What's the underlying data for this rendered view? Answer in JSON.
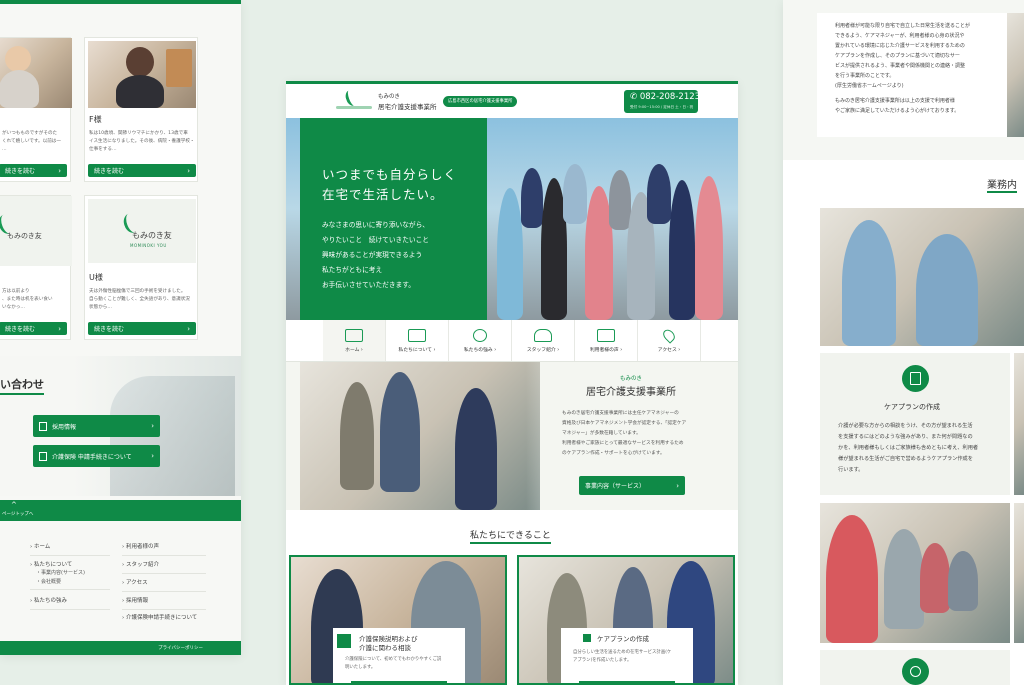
{
  "left": {
    "cards": [
      {
        "name": "",
        "text": "がいつもものですがそのた\nくれて嬉しいです。以前は一\n…",
        "button": "続きを読む"
      },
      {
        "name": "F様",
        "text": "私は10歳頃、関節リウマチにかかり、13歳で車\nイス生活になりました。その後、病院・養護学校・\n仕事をする…",
        "button": "続きを読む"
      },
      {
        "name": "",
        "text": "方は以前より\n、また時は机を表い食い\nいなかっ…",
        "button": "続きを読む"
      },
      {
        "name": "U様",
        "text": "夫は外傷性脳挫傷で三回の手術を受けました。\n自ら動くことが難しく、全失語があり、意識状況\n状態から…",
        "button": "続きを読む"
      }
    ],
    "logo_text": "もみのき友",
    "logo_sub": "MOMINOKI YOU",
    "contact_heading": "い合わせ",
    "contact_buttons": [
      "採用情報",
      "介護保険 申請手続きについて"
    ],
    "page_top": "ページトップへ",
    "footer_col1": [
      "ホーム",
      "私たちについて",
      "・事業内容(サービス)",
      "・会社概要",
      "私たちの強み"
    ],
    "footer_col2": [
      "利用者様の声",
      "スタッフ紹介",
      "アクセス",
      "採用情報",
      "介護保険申請手続きについて"
    ],
    "privacy": "プライバシーポリシー"
  },
  "center": {
    "logo_small": "もみのき",
    "logo_main": "居宅介護支援事業所",
    "badge": "広島市西区の居宅介護支援事業所",
    "phone": "082-208-2123",
    "hours": "受付 9:00~15:00 / 定休日 土・日・祝",
    "hero_title_1": "いつまでも自分らしく",
    "hero_title_2": "在宅で生活したい。",
    "hero_body": [
      "みなさまの思いに寄り添いながら、",
      "やりたいこと　続けていきたいこと",
      "興味があることが実現できるよう",
      "私たちがともに考え",
      "お手伝いさせていただきます。"
    ],
    "nav": [
      {
        "label": "ホーム",
        "icon": "home-icon"
      },
      {
        "label": "私たちについて",
        "icon": "book-icon"
      },
      {
        "label": "私たちの強み",
        "icon": "heart-hand-icon"
      },
      {
        "label": "スタッフ紹介",
        "icon": "staff-icon"
      },
      {
        "label": "利用者様の声",
        "icon": "chat-icon"
      },
      {
        "label": "アクセス",
        "icon": "map-pin-icon"
      }
    ],
    "about_small": "もみのき",
    "about_title": "居宅介護支援事業所",
    "about_body": [
      "もみのき居宅介護支援事業所には主任ケアマネジャーの",
      "資格及び日本ケアマネジメント学会が認定する、「認定ケア",
      "マネジャー」が多数在籍しています。",
      "利用者様やご家族にとって最適なサービスを利用するため",
      "のケアプラン作成・サポートを心がけています。"
    ],
    "about_button": "事業内容（サービス）",
    "can_heading": "私たちにできること",
    "card1_title_1": "介護保険説明および",
    "card1_title_2": "介護に関わる相談",
    "card1_text": "介護保険について、初めてでもわかりやすくご説\n明いたします。",
    "card2_title": "ケアプランの作成",
    "card2_text": "自分らしい生活を送るための在宅サービス計画(ケ\nアプラン)を作成いたします。"
  },
  "right": {
    "top_text": [
      "利用者様が可能な限り自宅で自立した日常生活を送ることが",
      "できるよう、ケアマネジャーが、利用者様の心身の状況や",
      "置かれている環境に応じた介護サービスを利用するための",
      "ケアプランを作成し、そのプランに基づいて適切なサー",
      "ビスが提供されるよう、事業者や関係機関との連絡・調整",
      "を行う事業所のことです。",
      "(厚生労働省ホームページより)",
      "",
      "もみのき居宅介護支援事業所は以上の支援で利用者様",
      "やご家族に満足していただけるよう心がけております。"
    ],
    "section_heading": "業務内",
    "care_title": "ケアプランの作成",
    "care_text": [
      "介護が必要な方からの相談をうけ、その方が望まれる生活",
      "を支援するにはどのような強みがあり、また何が問題なの",
      "かを、利用者様もしくはご家族様も含めともに考え、利用者",
      "様が望まれる生活がご自宅で営めるようケアプラン作成を",
      "行います。"
    ]
  }
}
